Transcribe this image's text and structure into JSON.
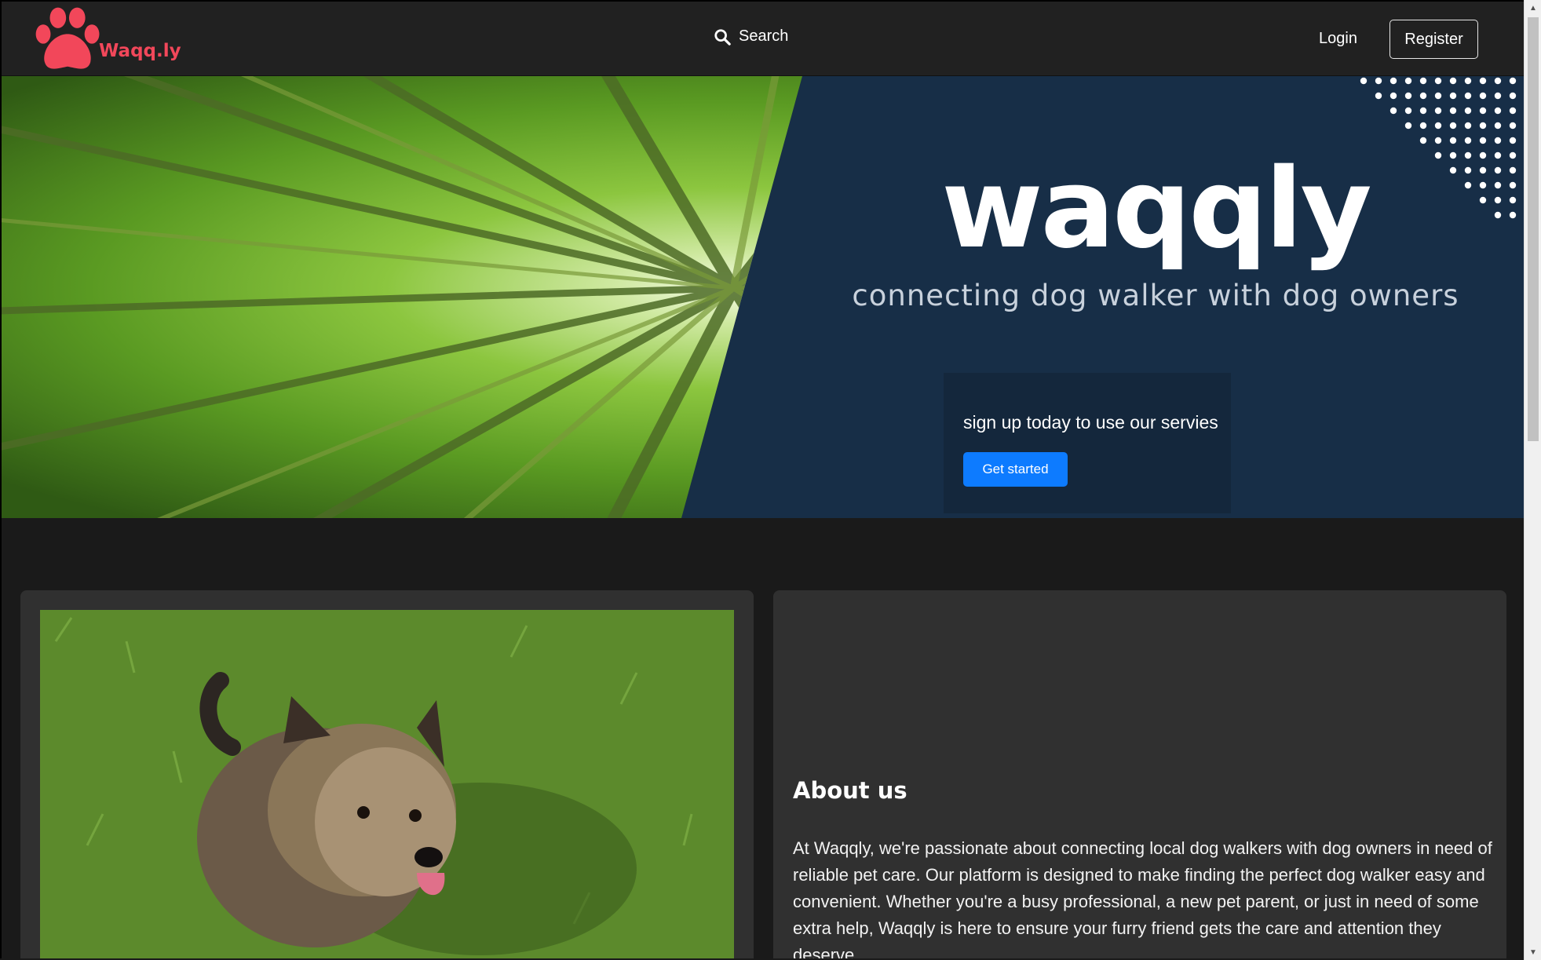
{
  "navbar": {
    "brand": "Waqq.ly",
    "logo_icon": "paw-icon",
    "search_icon": "search-icon",
    "search_label": "Search",
    "login_label": "Login",
    "register_label": "Register"
  },
  "hero": {
    "title": "waqqly",
    "tagline": "connecting dog walker with dog owners",
    "signup_text": "sign up today to use our servies",
    "cta_label": "Get started"
  },
  "about": {
    "title": "About us",
    "text": "At Waqqly, we're passionate about connecting local dog walkers with dog owners in need of reliable pet care. Our platform is designed to make finding the perfect dog walker easy and convenient. Whether you're a busy professional, a new pet parent, or just in need of some extra help, Waqqly is here to ensure your furry friend gets the care and attention they deserve."
  },
  "colors": {
    "brand": "#f2475a",
    "hero_bg": "#172e47",
    "cta": "#0d7bff",
    "page_bg": "#1a1a1a",
    "card_bg": "#303030"
  }
}
